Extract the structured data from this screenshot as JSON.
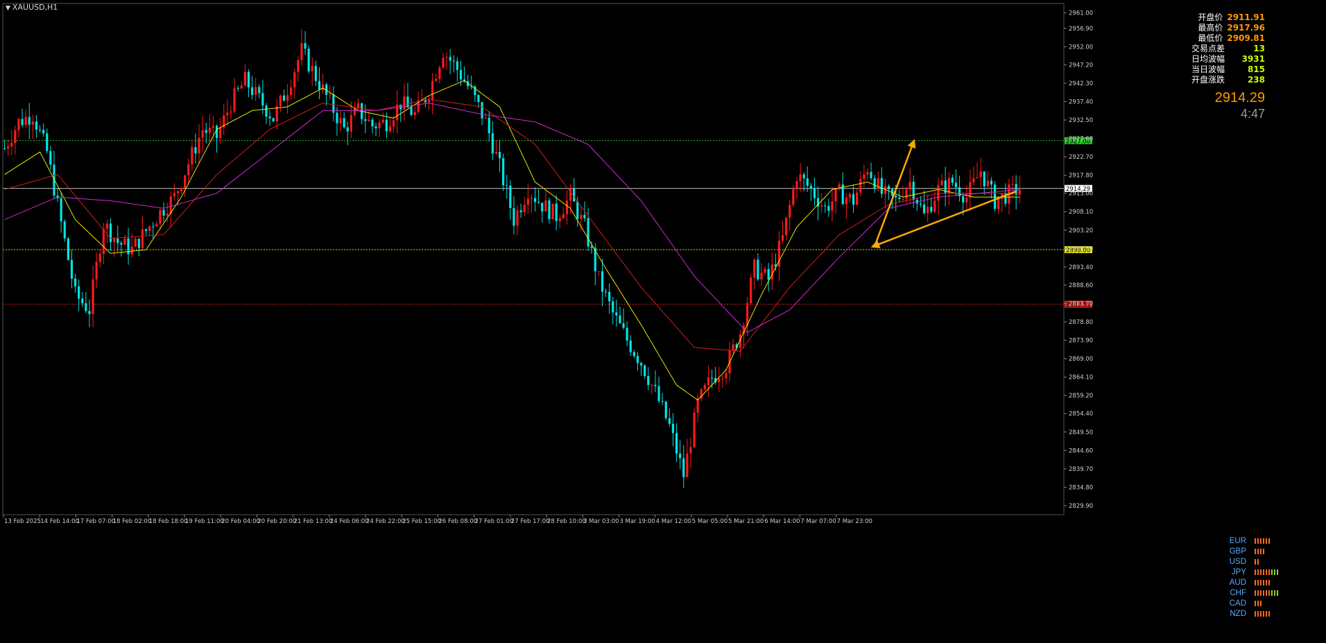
{
  "window": {
    "title": "XAUUSD,H1"
  },
  "info_panel": [
    {
      "label": "开盘价",
      "value": "2911.91",
      "accent": "orange"
    },
    {
      "label": "最高价",
      "value": "2917.96",
      "accent": "orange"
    },
    {
      "label": "最低价",
      "value": "2909.81",
      "accent": "orange"
    },
    {
      "label": "交易点差",
      "value": "13",
      "accent": "green"
    },
    {
      "label": "日均波幅",
      "value": "3931",
      "accent": "green"
    },
    {
      "label": "当日波幅",
      "value": "815",
      "accent": "green"
    },
    {
      "label": "开盘涨跌",
      "value": "238",
      "accent": "green"
    }
  ],
  "current_price": "2914.29",
  "countdown": "4:47",
  "currency_strength": [
    {
      "currency": "EUR",
      "bars": 6
    },
    {
      "currency": "GBP",
      "bars": 4
    },
    {
      "currency": "USD",
      "bars": 2
    },
    {
      "currency": "JPY",
      "bars": 9
    },
    {
      "currency": "AUD",
      "bars": 6
    },
    {
      "currency": "CHF",
      "bars": 9
    },
    {
      "currency": "CAD",
      "bars": 3
    },
    {
      "currency": "NZD",
      "bars": 6
    }
  ],
  "colors": {
    "background": "#000000",
    "bull_candle": "#ff1a1a",
    "bear_candle": "#00e5e5",
    "ma_fast": "#e8e800",
    "ma_mid": "#d41c1c",
    "ma_slow": "#d02ad0",
    "zone_fill": "#0000ff",
    "forecast_arrow": "#ffaa00",
    "resistance": "#22cc22",
    "support_yellow": "#e5e500",
    "support_red": "#d42020",
    "axis_text": "#d0d0d0"
  },
  "chart_data": {
    "type": "candlestick",
    "symbol": "XAUUSD",
    "timeframe": "H1",
    "ylim": [
      2827.5,
      2963.5
    ],
    "price_ticks": [
      "2961.00",
      "2956.90",
      "2952.00",
      "2947.20",
      "2942.30",
      "2937.40",
      "2932.50",
      "2927.60",
      "2922.70",
      "2917.80",
      "2913.00",
      "2908.10",
      "2903.20",
      "2898.30",
      "2893.40",
      "2888.60",
      "2883.70",
      "2878.80",
      "2873.90",
      "2869.00",
      "2864.10",
      "2859.20",
      "2854.40",
      "2849.50",
      "2844.60",
      "2839.70",
      "2834.80",
      "2829.90"
    ],
    "time_labels": [
      "13 Feb 2025",
      "14 Feb 14:00",
      "17 Feb 07:00",
      "18 Feb 02:00",
      "18 Feb 18:00",
      "19 Feb 11:00",
      "20 Feb 04:00",
      "20 Feb 20:00",
      "21 Feb 13:00",
      "24 Feb 06:00",
      "24 Feb 22:00",
      "25 Feb 15:00",
      "26 Feb 08:00",
      "27 Feb 01:00",
      "27 Feb 17:00",
      "28 Feb 10:00",
      "3 Mar 03:00",
      "3 Mar 19:00",
      "4 Mar 12:00",
      "5 Mar 05:00",
      "5 Mar 21:00",
      "6 Mar 14:00",
      "7 Mar 07:00",
      "7 Mar 23:00"
    ],
    "level_lines": [
      {
        "price": 2927.0,
        "label": "2927.00",
        "color": "#22cc22"
      },
      {
        "price": 2914.29,
        "label": "2914.29",
        "color": "#c0c0c0"
      },
      {
        "price": 2898.0,
        "label": "2898.00",
        "color": "#e5e500"
      },
      {
        "price": 2883.5,
        "label": "2883.50",
        "color": "#d42020"
      }
    ],
    "zone": {
      "price_top": 2927.0,
      "price_bottom": 2898.0
    },
    "forecast_path": [
      2913.5,
      2898.8,
      2927.0
    ],
    "close_path": [
      [
        0,
        2925
      ],
      [
        4,
        2932
      ],
      [
        8,
        2934
      ],
      [
        12,
        2924
      ],
      [
        16,
        2905
      ],
      [
        20,
        2886
      ],
      [
        24,
        2882
      ],
      [
        28,
        2905
      ],
      [
        32,
        2900
      ],
      [
        36,
        2898
      ],
      [
        40,
        2903
      ],
      [
        44,
        2908
      ],
      [
        48,
        2912
      ],
      [
        52,
        2921
      ],
      [
        56,
        2930
      ],
      [
        60,
        2928
      ],
      [
        64,
        2937
      ],
      [
        68,
        2943
      ],
      [
        72,
        2938
      ],
      [
        76,
        2933
      ],
      [
        80,
        2941
      ],
      [
        84,
        2951
      ],
      [
        88,
        2944
      ],
      [
        92,
        2937
      ],
      [
        96,
        2930
      ],
      [
        100,
        2935
      ],
      [
        104,
        2931
      ],
      [
        108,
        2932
      ],
      [
        112,
        2937
      ],
      [
        116,
        2934
      ],
      [
        120,
        2940
      ],
      [
        124,
        2951
      ],
      [
        128,
        2946
      ],
      [
        132,
        2940
      ],
      [
        136,
        2932
      ],
      [
        140,
        2920
      ],
      [
        144,
        2906
      ],
      [
        148,
        2914
      ],
      [
        152,
        2910
      ],
      [
        156,
        2907
      ],
      [
        160,
        2912
      ],
      [
        164,
        2904
      ],
      [
        168,
        2890
      ],
      [
        172,
        2881
      ],
      [
        176,
        2874
      ],
      [
        180,
        2868
      ],
      [
        184,
        2860
      ],
      [
        188,
        2851
      ],
      [
        192,
        2838
      ],
      [
        196,
        2857
      ],
      [
        200,
        2864
      ],
      [
        204,
        2867
      ],
      [
        208,
        2876
      ],
      [
        212,
        2893
      ],
      [
        216,
        2890
      ],
      [
        220,
        2901
      ],
      [
        224,
        2918
      ],
      [
        228,
        2914
      ],
      [
        232,
        2909
      ],
      [
        236,
        2913
      ],
      [
        240,
        2911
      ],
      [
        244,
        2920
      ],
      [
        248,
        2913
      ],
      [
        252,
        2911
      ],
      [
        256,
        2916
      ],
      [
        260,
        2907
      ],
      [
        264,
        2914
      ],
      [
        268,
        2916
      ],
      [
        272,
        2912
      ],
      [
        276,
        2919
      ],
      [
        280,
        2911
      ],
      [
        284,
        2913
      ],
      [
        287,
        2914.29
      ]
    ],
    "ma_fast": [
      [
        0,
        2918
      ],
      [
        10,
        2924
      ],
      [
        20,
        2906
      ],
      [
        30,
        2897
      ],
      [
        40,
        2898
      ],
      [
        50,
        2912
      ],
      [
        60,
        2930
      ],
      [
        70,
        2935
      ],
      [
        80,
        2936
      ],
      [
        90,
        2941
      ],
      [
        100,
        2935
      ],
      [
        110,
        2933
      ],
      [
        120,
        2939
      ],
      [
        130,
        2943
      ],
      [
        140,
        2936
      ],
      [
        150,
        2916
      ],
      [
        160,
        2909
      ],
      [
        170,
        2893
      ],
      [
        180,
        2878
      ],
      [
        190,
        2862
      ],
      [
        196,
        2858
      ],
      [
        204,
        2866
      ],
      [
        214,
        2886
      ],
      [
        224,
        2904
      ],
      [
        234,
        2914
      ],
      [
        244,
        2916
      ],
      [
        254,
        2912
      ],
      [
        264,
        2914
      ],
      [
        274,
        2912
      ],
      [
        287,
        2912
      ]
    ],
    "ma_mid": [
      [
        0,
        2914
      ],
      [
        15,
        2918
      ],
      [
        30,
        2901
      ],
      [
        45,
        2902
      ],
      [
        60,
        2918
      ],
      [
        75,
        2930
      ],
      [
        90,
        2937
      ],
      [
        105,
        2935
      ],
      [
        120,
        2938
      ],
      [
        135,
        2936
      ],
      [
        150,
        2926
      ],
      [
        165,
        2907
      ],
      [
        180,
        2888
      ],
      [
        195,
        2872
      ],
      [
        208,
        2871
      ],
      [
        222,
        2888
      ],
      [
        236,
        2902
      ],
      [
        250,
        2910
      ],
      [
        264,
        2913
      ],
      [
        287,
        2913
      ]
    ],
    "ma_slow": [
      [
        0,
        2906
      ],
      [
        15,
        2912
      ],
      [
        30,
        2911
      ],
      [
        45,
        2909
      ],
      [
        60,
        2913
      ],
      [
        75,
        2924
      ],
      [
        90,
        2935
      ],
      [
        105,
        2935
      ],
      [
        120,
        2937
      ],
      [
        135,
        2934
      ],
      [
        150,
        2932
      ],
      [
        165,
        2926
      ],
      [
        180,
        2911
      ],
      [
        195,
        2891
      ],
      [
        210,
        2876
      ],
      [
        222,
        2882
      ],
      [
        236,
        2896
      ],
      [
        250,
        2909
      ],
      [
        264,
        2912
      ],
      [
        287,
        2914
      ]
    ]
  }
}
